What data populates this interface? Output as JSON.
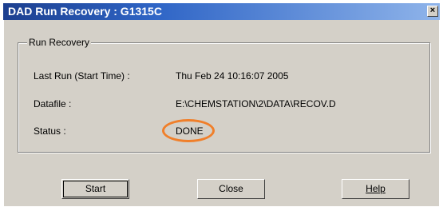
{
  "window": {
    "title": "DAD Run Recovery : G1315C",
    "close_glyph": "×"
  },
  "group": {
    "title": "Run Recovery"
  },
  "fields": {
    "last_run_label": "Last Run (Start Time) :",
    "last_run_value": "Thu Feb 24 10:16:07 2005",
    "datafile_label": "Datafile :",
    "datafile_value": "E:\\CHEMSTATION\\2\\DATA\\RECOV.D",
    "status_label": "Status :",
    "status_value": "DONE"
  },
  "buttons": {
    "start": "Start",
    "close": "Close",
    "help": "Help"
  },
  "colors": {
    "window": "#d4d0c8",
    "title_start": "#1c3f8f",
    "title_end": "#8fb4ea",
    "highlight": "#f07f2a"
  }
}
